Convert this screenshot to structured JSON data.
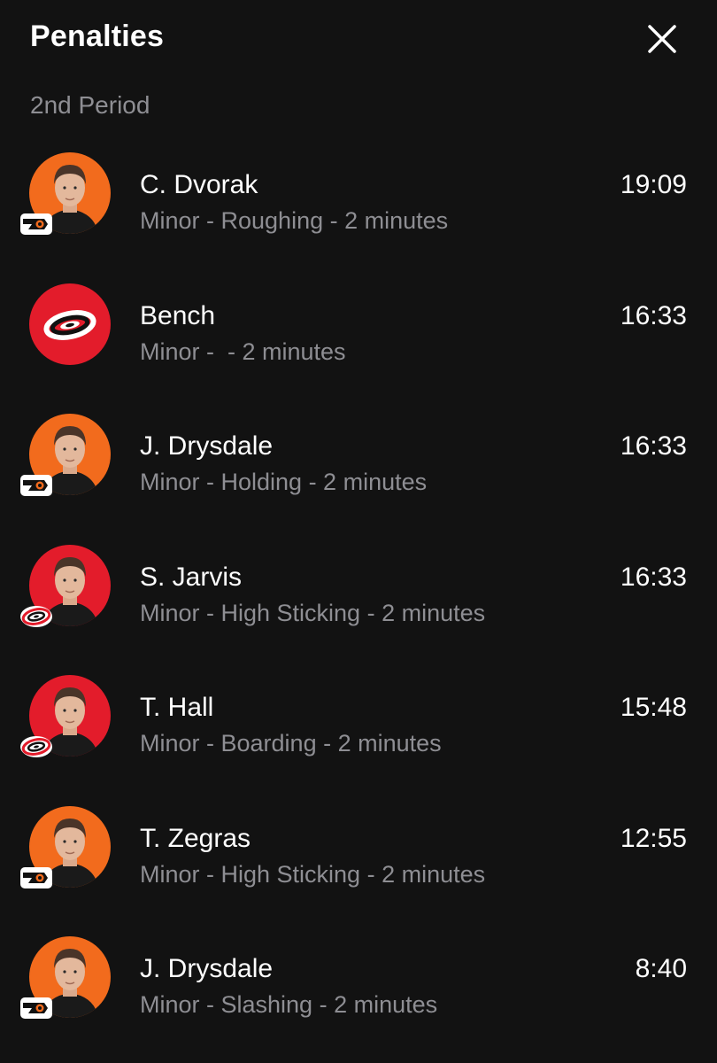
{
  "header": {
    "title": "Penalties",
    "close_icon": "close-icon"
  },
  "section": {
    "period": "2nd Period"
  },
  "colors": {
    "background": "#121212",
    "flyers_orange": "#f26b1d",
    "hurricanes_red": "#e31c2b",
    "secondary_text": "#8e8e93"
  },
  "penalties": [
    {
      "name": "C. Dvorak",
      "detail": "Minor - Roughing - 2 minutes",
      "time": "19:09",
      "team": "flyers",
      "avatar": "player-headshot"
    },
    {
      "name": "Bench",
      "detail": "Minor -  - 2 minutes",
      "time": "16:33",
      "team": "hurricanes",
      "avatar": "team-logo"
    },
    {
      "name": "J. Drysdale",
      "detail": "Minor - Holding - 2 minutes",
      "time": "16:33",
      "team": "flyers",
      "avatar": "player-headshot"
    },
    {
      "name": "S. Jarvis",
      "detail": "Minor - High Sticking - 2 minutes",
      "time": "16:33",
      "team": "hurricanes",
      "avatar": "player-headshot"
    },
    {
      "name": "T. Hall",
      "detail": "Minor - Boarding - 2 minutes",
      "time": "15:48",
      "team": "hurricanes",
      "avatar": "player-headshot"
    },
    {
      "name": "T. Zegras",
      "detail": "Minor - High Sticking - 2 minutes",
      "time": "12:55",
      "team": "flyers",
      "avatar": "player-headshot"
    },
    {
      "name": "J. Drysdale",
      "detail": "Minor - Slashing - 2 minutes",
      "time": "8:40",
      "team": "flyers",
      "avatar": "player-headshot"
    }
  ]
}
